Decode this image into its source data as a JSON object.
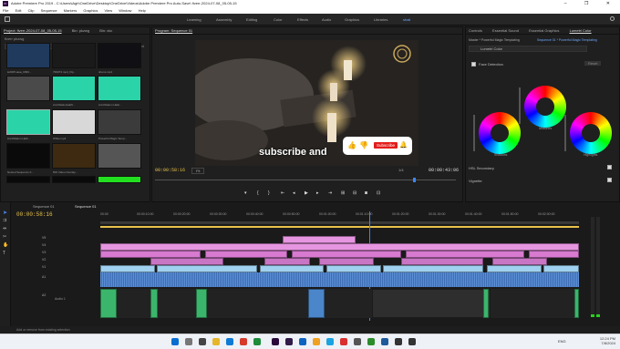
{
  "window": {
    "title": "Adobe Premiere Pro 2019 - C:\\Users\\iAgh\\OneDrive\\Desktop\\OneDrive\\Videos\\Adobe Premiere Pro Auto-Save\\ fiverr-2024-07-08_05-05-15",
    "app_badge": "Pr",
    "controls": "– ❐ ✕"
  },
  "menu": [
    "File",
    "Edit",
    "Clip",
    "Sequence",
    "Markers",
    "Graphics",
    "View",
    "Window",
    "Help"
  ],
  "workspaces": [
    {
      "label": "Learning",
      "active": false
    },
    {
      "label": "Assembly",
      "active": false
    },
    {
      "label": "Editing",
      "active": false
    },
    {
      "label": "Color",
      "active": false
    },
    {
      "label": "Effects",
      "active": false
    },
    {
      "label": "Audio",
      "active": false
    },
    {
      "label": "Graphics",
      "active": false
    },
    {
      "label": "Libraries",
      "active": false
    },
    {
      "label": "shail",
      "active": true
    }
  ],
  "project_panel": {
    "tabs": [
      "Project: fiverr-2024-07-08_05-05-15",
      "Bin: pkzwg",
      "Bin: xkc"
    ],
    "path": "fiverr pkzwg",
    "count": "1 of 52 items selected",
    "items": [
      {
        "name": "le0005.aiaa_0096...",
        "duration": "0:15",
        "color": "#1f3a5c"
      },
      {
        "name": "799073.mp4_f3p...",
        "duration": "0:09",
        "color": "#1a1a1a"
      },
      {
        "name": "drums.mp4",
        "duration": "",
        "color": "#0f0f14"
      },
      {
        "name": "",
        "duration": "",
        "color": "#4a4a4a"
      },
      {
        "name": "AnnihilationHalfl...",
        "duration": "11:32:00",
        "color": "#2bd3a8"
      },
      {
        "name": "Annihilation Hallo...",
        "duration": "18:56:01",
        "color": "#2bd3a8"
      },
      {
        "name": "Annihilation Halb...",
        "duration": "1:00:04",
        "color": "#2bd3a8"
      },
      {
        "name": "White.mp4",
        "duration": "",
        "color": "#d8d8d8"
      },
      {
        "name": "Powerful Magic Temp...",
        "duration": "1:30",
        "color": "#3b3b3b"
      },
      {
        "name": "Nested Sequence 0...",
        "duration": "",
        "color": "#0a0a0a"
      },
      {
        "name": "500 Video-Overlay...",
        "duration": "4:24",
        "color": "#3d2a10"
      },
      {
        "name": "",
        "duration": "",
        "color": "#555"
      },
      {
        "name": "",
        "duration": "",
        "color": "#0a0a0a"
      },
      {
        "name": "",
        "duration": "",
        "color": "#0a0a0a"
      },
      {
        "name": "",
        "duration": "",
        "color": "#22e01f"
      }
    ]
  },
  "program": {
    "tab": "Program: Sequence 01",
    "subtitle": "subscribe and",
    "timecode": "00:00:58:16",
    "fit": "Fit",
    "fraction": "1/4",
    "duration": "00:00:43:06",
    "subscribe_btn": "Subscribe"
  },
  "lumetri": {
    "tabs": [
      "Controls",
      "Essential Sound",
      "Essential Graphics",
      "Lumetri Color"
    ],
    "source": "Master * Powerful Magic Templating",
    "sequence": "Sequence 01 * Powerful Magic Templating",
    "effect": "Lumetri Color",
    "face_detection": "Face Detection",
    "reset": "Reset",
    "wheels": [
      {
        "label": "Midtones"
      },
      {
        "label": "Shadows"
      },
      {
        "label": "Highlights"
      }
    ],
    "hsl": "HSL Secondary",
    "vignette": "Vignette"
  },
  "timeline": {
    "tab": "Sequence 01",
    "timecode": "00:00:58:16",
    "ruler": [
      "00:00",
      "00:00:10:00",
      "00:00:20:00",
      "00:00:30:00",
      "00:00:40:00",
      "00:00:50:00",
      "00:01:00:00",
      "00:01:10:00",
      "00:01:20:00",
      "00:01:30:00",
      "00:01:40:00",
      "00:01:50:00",
      "00:02:00:00"
    ],
    "video_tracks": [
      "V5",
      "V4",
      "V3",
      "V2",
      "V1"
    ],
    "audio_tracks": [
      "A1",
      "A2"
    ],
    "audio_label": "Audio 1",
    "status": "Add or remove from existing selection"
  },
  "taskbar": {
    "time": "12:24 PM",
    "date": "7/8/2024",
    "lang": "ENG"
  }
}
